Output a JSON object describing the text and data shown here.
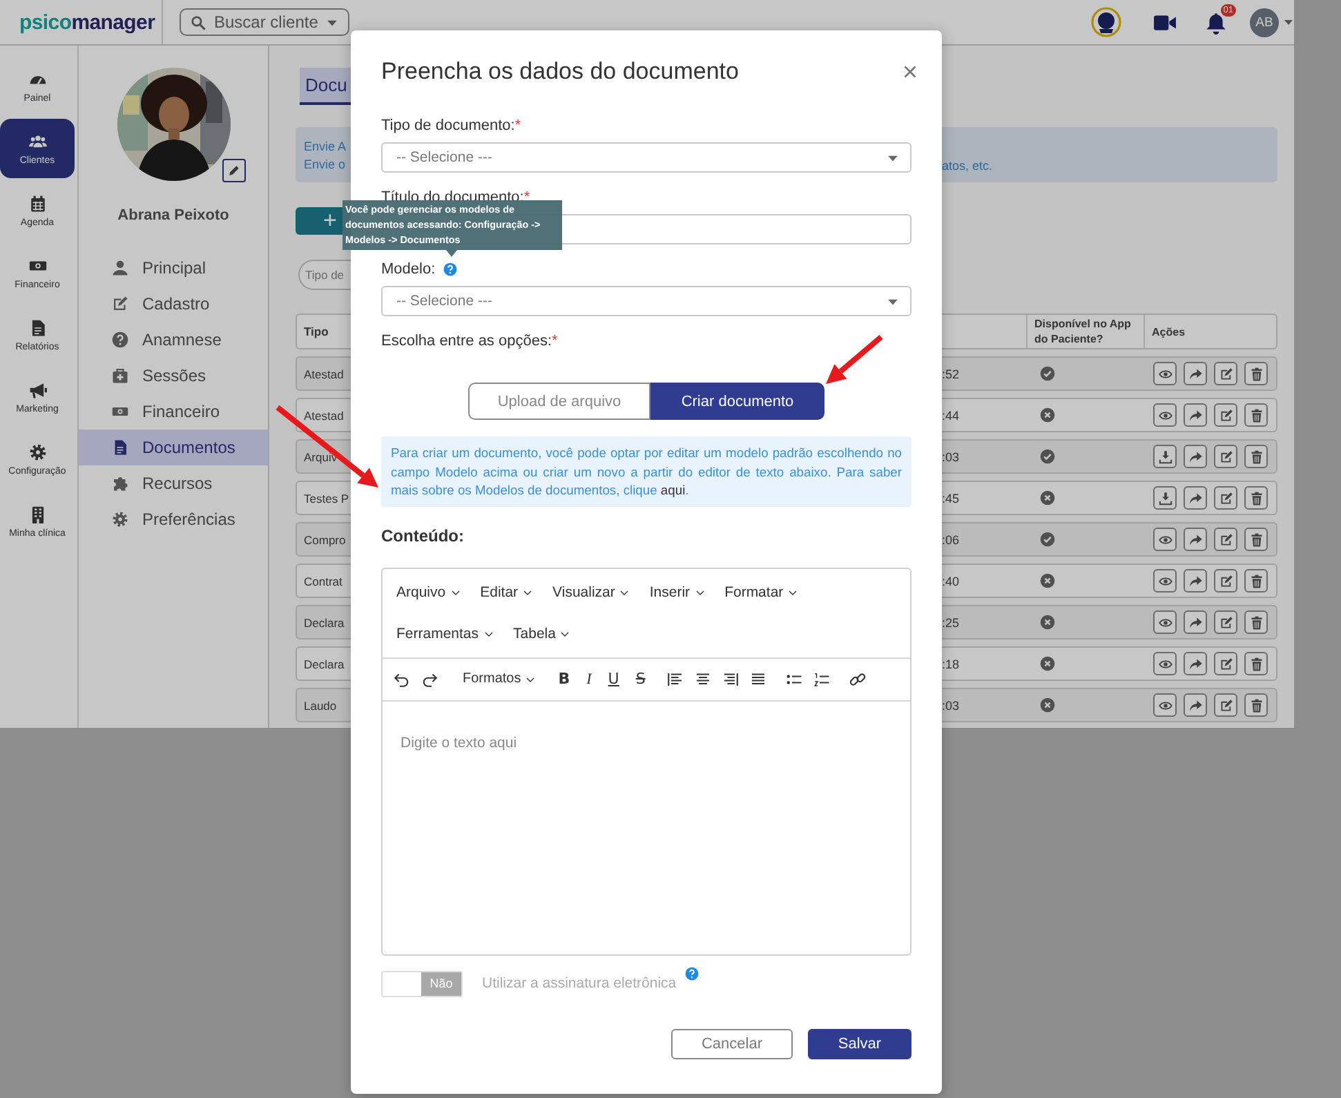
{
  "header": {
    "logo": {
      "first": "psico",
      "second": "manager"
    },
    "search_button": "Buscar cliente",
    "notification_count": "01",
    "avatar_initials": "AB"
  },
  "nav": [
    {
      "label": "Painel",
      "selected": false
    },
    {
      "label": "Clientes",
      "selected": true
    },
    {
      "label": "Agenda",
      "selected": false
    },
    {
      "label": "Financeiro",
      "selected": false
    },
    {
      "label": "Relatórios",
      "selected": false
    },
    {
      "label": "Marketing",
      "selected": false
    },
    {
      "label": "Configuração",
      "selected": false
    },
    {
      "label": "Minha clínica",
      "selected": false
    }
  ],
  "client": {
    "name": "Abrana Peixoto",
    "menu": [
      {
        "label": "Principal",
        "selected": false
      },
      {
        "label": "Cadastro",
        "selected": false
      },
      {
        "label": "Anamnese",
        "selected": false
      },
      {
        "label": "Sessões",
        "selected": false
      },
      {
        "label": "Financeiro",
        "selected": false
      },
      {
        "label": "Documentos",
        "selected": true
      },
      {
        "label": "Recursos",
        "selected": false
      },
      {
        "label": "Preferências",
        "selected": false
      }
    ]
  },
  "page_tab": {
    "label": "Docu",
    "selected": true
  },
  "alert": {
    "lines": [
      "Envie A",
      "Envie o"
    ],
    "continuation": "atos, etc."
  },
  "add_button": "+",
  "filter": {
    "placeholder": "Tipo de"
  },
  "table": {
    "columns": [
      {
        "label": "Tipo"
      },
      {
        "label": "Disponível no App do Paciente?"
      },
      {
        "label": "Ações"
      }
    ],
    "rows": [
      {
        "type": "Atestad",
        "column_2": ":52",
        "available": true,
        "kind": "view"
      },
      {
        "type": "Atestad",
        "column_2": ":44",
        "available": false,
        "kind": "view"
      },
      {
        "type": "Arquiv",
        "column_2": ":03",
        "available": true,
        "kind": "download"
      },
      {
        "type": "Testes P",
        "column_2": ":45",
        "available": false,
        "kind": "download"
      },
      {
        "type": "Compro",
        "column_2": ":06",
        "available": true,
        "kind": "view"
      },
      {
        "type": "Contrat",
        "column_2": ":40",
        "available": false,
        "kind": "view"
      },
      {
        "type": "Declara",
        "column_2": ":25",
        "available": false,
        "kind": "view"
      },
      {
        "type": "Declara",
        "column_2": ":18",
        "available": false,
        "kind": "view"
      },
      {
        "type": "Laudo",
        "column_2": ":03",
        "available": false,
        "kind": "view"
      }
    ]
  },
  "modal": {
    "title": "Preencha os dados do documento",
    "fields": [
      {
        "label": "Tipo de documento:",
        "required_mark": "*",
        "kind": "select",
        "value": "-- Selecione ---",
        "help": false
      },
      {
        "label": "Título do documento:",
        "required_mark": "*",
        "kind": "text",
        "help": false
      },
      {
        "label": "Modelo:",
        "kind": "select",
        "value": "-- Selecione ---",
        "help": true
      }
    ],
    "options_label": "Escolha entre as opções:",
    "options_required_mark": "*",
    "options": [
      {
        "label": "Upload de arquivo",
        "selected": false
      },
      {
        "label": "Criar documento",
        "selected": true
      }
    ],
    "info": {
      "text": "Para criar um documento, você pode optar por editar um modelo padrão escolhendo no campo Modelo acima ou criar um novo a partir do editor de texto abaixo. Para saber mais sobre os Modelos de documentos, clique ",
      "link": "aqui",
      "end": "."
    },
    "content_label": "Conteúdo:",
    "editor": {
      "menubar": [
        [
          "Arquivo",
          "Editar",
          "Visualizar",
          "Inserir",
          "Formatar"
        ],
        [
          "Ferramentas",
          "Tabela"
        ]
      ],
      "formats_dropdown": "Formatos",
      "format_buttons": [
        "B",
        "I",
        "U",
        "S"
      ],
      "placeholder": "Digite o texto aqui"
    },
    "signature": {
      "on": false,
      "toggle_text": "Não",
      "label": "Utilizar a assinatura eletrônica"
    },
    "buttons": [
      {
        "label": "Cancelar",
        "kind": "secondary"
      },
      {
        "label": "Salvar",
        "kind": "primary"
      }
    ]
  },
  "tooltip": "Você pode gerenciar os modelos de documentos acessando: Configuração -> Modelos -> Documentos"
}
